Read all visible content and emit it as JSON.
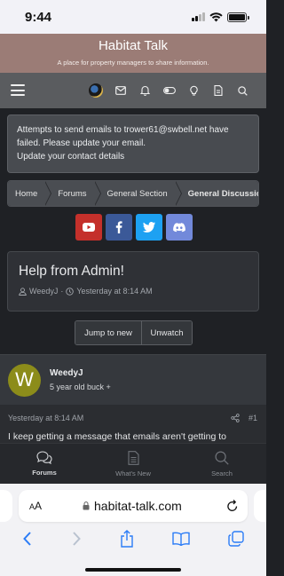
{
  "status_bar": {
    "time": "9:44"
  },
  "site": {
    "title": "Habitat Talk",
    "subtitle": "A place for property managers to share information."
  },
  "nav": {
    "icons": [
      "menu-icon",
      "avatar",
      "mail-icon",
      "bell-icon",
      "toggle-icon",
      "lightbulb-icon",
      "document-icon",
      "search-icon"
    ]
  },
  "notice": {
    "line1": "Attempts to send emails to trower61@swbell.net have",
    "line2": "failed. Please update your email.",
    "link": "Update your contact details"
  },
  "breadcrumb": {
    "items": [
      "Home",
      "Forums",
      "General Section"
    ],
    "current": "General Discussion"
  },
  "share": {
    "buttons": [
      "youtube",
      "facebook",
      "twitter",
      "discord"
    ],
    "colors": {
      "youtube": "#c4302b",
      "facebook": "#3b5998",
      "twitter": "#1da1f2",
      "discord": "#7289da"
    }
  },
  "thread": {
    "title": "Help from Admin!",
    "author": "WeedyJ",
    "separator": "·",
    "date": "Yesterday at 8:14 AM"
  },
  "actions": {
    "jump_to_new": "Jump to new",
    "unwatch": "Unwatch"
  },
  "post": {
    "avatar_letter": "W",
    "username": "WeedyJ",
    "user_title": "5 year old buck +",
    "date": "Yesterday at 8:14 AM",
    "number": "#1",
    "body": "I keep getting a message that emails aren't getting to"
  },
  "tabbar": {
    "tabs": [
      {
        "label": "Forums",
        "active": true
      },
      {
        "label": "What's New",
        "active": false
      },
      {
        "label": "Search",
        "active": false
      }
    ]
  },
  "browser": {
    "aa_large": "A",
    "aa_small": "A",
    "url": "habitat-talk.com"
  }
}
